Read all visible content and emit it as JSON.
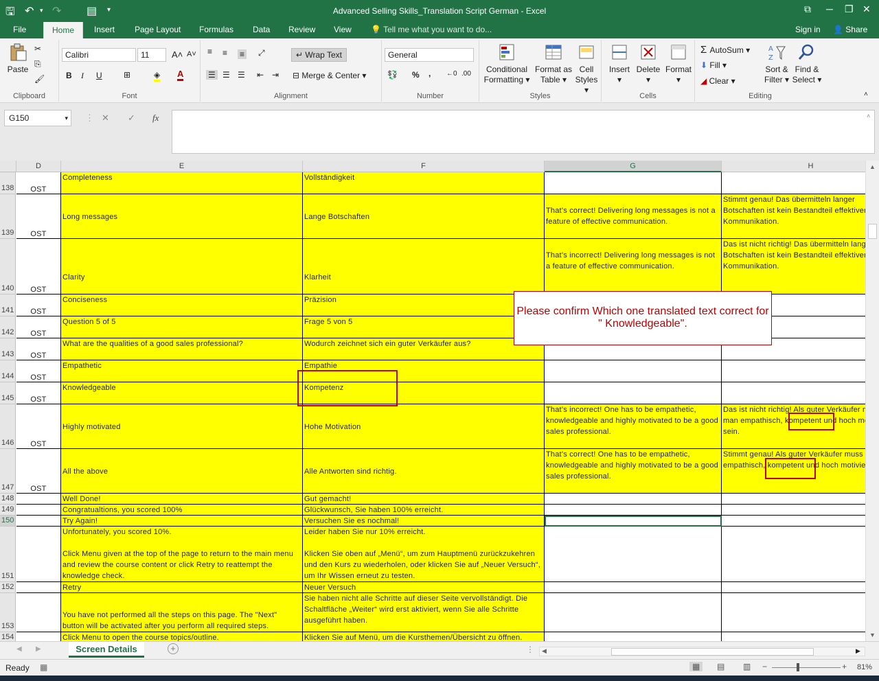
{
  "window": {
    "title": "Advanced Selling Skills_Translation Script German - Excel"
  },
  "menu": {
    "file": "File",
    "tabs": [
      "Home",
      "Insert",
      "Page Layout",
      "Formulas",
      "Data",
      "Review",
      "View"
    ],
    "tell_me": "Tell me what you want to do...",
    "sign_in": "Sign in",
    "share": "Share"
  },
  "ribbon": {
    "clipboard": {
      "paste": "Paste",
      "label": "Clipboard"
    },
    "font": {
      "name": "Calibri",
      "size": "11",
      "bold": "B",
      "italic": "I",
      "underline": "U",
      "label": "Font"
    },
    "alignment": {
      "wrap": "Wrap Text",
      "merge": "Merge & Center",
      "label": "Alignment"
    },
    "number": {
      "format": "General",
      "percent": "%",
      "comma": ",",
      "label": "Number"
    },
    "styles": {
      "cond1": "Conditional",
      "cond2": "Formatting",
      "fmt1": "Format as",
      "fmt2": "Table",
      "cell1": "Cell",
      "cell2": "Styles",
      "label": "Styles"
    },
    "cells": {
      "insert": "Insert",
      "delete": "Delete",
      "format": "Format",
      "label": "Cells"
    },
    "editing": {
      "autosum": "AutoSum",
      "fill": "Fill",
      "clear": "Clear",
      "sort1": "Sort &",
      "sort2": "Filter",
      "find1": "Find &",
      "find2": "Select",
      "label": "Editing"
    }
  },
  "formula": {
    "name_box": "G150",
    "fx": "fx",
    "cancel": "✕",
    "enter": "✓",
    "value": ""
  },
  "columns": [
    "D",
    "E",
    "F",
    "G",
    "H"
  ],
  "rows": [
    {
      "num": "138",
      "d": "OST",
      "e": "Completeness",
      "f": "Vollständigkeit",
      "g": "",
      "h": ""
    },
    {
      "num": "139",
      "d": "OST",
      "e": "Long messages",
      "f": "Lange Botschaften",
      "g": "That’s correct! Delivering long messages is not a feature of effective communication.",
      "h": "Stimmt genau! Das übermitteln langer Botschaften ist kein Bestandteil effektiver Kommunikation."
    },
    {
      "num": "140",
      "d": "OST",
      "e": "Clarity",
      "f": "Klarheit",
      "g": "That’s incorrect! Delivering long messages is not a feature of effective communication.",
      "h": "Das ist nicht richtig! Das übermitteln langer Botschaften ist kein Bestandteil effektiver Kommunikation."
    },
    {
      "num": "141",
      "d": "OST",
      "e": "Conciseness",
      "f": "Präzision",
      "g": "",
      "h": ""
    },
    {
      "num": "142",
      "d": "OST",
      "e": "Question 5 of 5",
      "f": "Frage 5 von 5",
      "g": "",
      "h": ""
    },
    {
      "num": "143",
      "d": "OST",
      "e": "What are the qualities of a good sales professional?",
      "f": "Wodurch zeichnet sich ein guter Verkäufer aus?",
      "g": "",
      "h": ""
    },
    {
      "num": "144",
      "d": "OST",
      "e": "Empathetic",
      "f": "Empathie",
      "g": "",
      "h": ""
    },
    {
      "num": "145",
      "d": "OST",
      "e": "Knowledgeable",
      "f": "Kompetenz",
      "g": "",
      "h": ""
    },
    {
      "num": "146",
      "d": "OST",
      "e": "Highly motivated",
      "f": "Hohe Motivation",
      "g": "That’s incorrect! One has to be empathetic, knowledgeable and highly motivated to be a good sales professional.",
      "h": "Das ist nicht richtig! Als guter Verkäufer muss man empathisch, kompetent und hoch motiviert sein."
    },
    {
      "num": "147",
      "d": "OST",
      "e": "All the above",
      "f": "Alle Antworten sind richtig.",
      "g": "That’s correct! One has to be empathetic, knowledgeable and highly motivated to be a good sales professional.",
      "h": "Stimmt genau! Als guter Verkäufer muss man empathisch, kompetent und hoch motiviert sein."
    },
    {
      "num": "148",
      "d": "",
      "e": "Well Done!",
      "f": "Gut gemacht!",
      "g": "",
      "h": ""
    },
    {
      "num": "149",
      "d": "",
      "e": "Congratualtions, you scored 100%",
      "f": "Glückwunsch, Sie haben 100% erreicht.",
      "g": "",
      "h": ""
    },
    {
      "num": "150",
      "d": "",
      "e": "Try Again!",
      "f": "Versuchen Sie es nochmal!",
      "g": "",
      "h": ""
    },
    {
      "num": "151",
      "d": "",
      "e": "Unfortunately, you scored 10%.\n\nClick Menu given at the top of the page to return to the main menu and review the course content or click Retry to reattempt the knowledge check.",
      "f": "Leider haben Sie nur 10% erreicht.\n\nKlicken Sie oben auf „Menü“, um zum Hauptmenü zurückzukehren und den Kurs zu wiederholen, oder klicken Sie auf „Neuer Versuch“, um Ihr Wissen erneut zu testen.",
      "g": "",
      "h": ""
    },
    {
      "num": "152",
      "d": "",
      "e": "Retry",
      "f": "Neuer Versuch",
      "g": "",
      "h": ""
    },
    {
      "num": "153",
      "d": "",
      "e": "You have not performed all the steps on this page. The \"Next\" button will be activated after you perform all required steps.",
      "f": "Sie haben nicht alle Schritte auf dieser Seite vervollständigt. Die Schaltfläche „Weiter“ wird erst aktiviert, wenn Sie alle Schritte ausgeführt haben.",
      "g": "",
      "h": ""
    },
    {
      "num": "154",
      "d": "",
      "e": "Click Menu to open the course topics/outline.",
      "f": "Klicken Sie auf Menü, um die Kursthemen/Übersicht zu öffnen.",
      "g": "",
      "h": ""
    }
  ],
  "callout": "Please confirm Which one translated text correct for \" Knowledgeable\".",
  "sheet": {
    "tab": "Screen Details",
    "add": "+"
  },
  "status": {
    "ready": "Ready",
    "zoom": "81%"
  },
  "colors": {
    "excel_green": "#217346",
    "highlight": "#ffff00",
    "annotation": "#c00000"
  }
}
